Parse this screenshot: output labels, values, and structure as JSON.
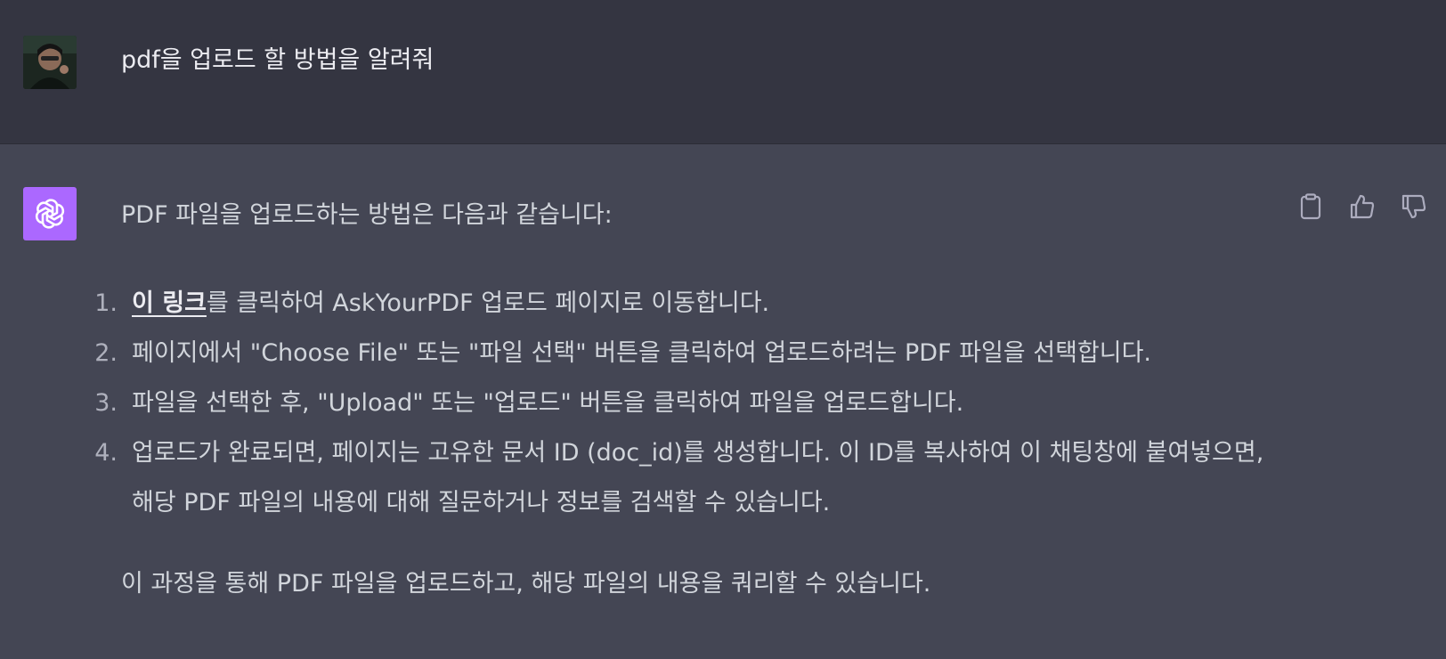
{
  "user": {
    "message": "pdf을 업로드 할 방법을 알려줘",
    "avatar_icon": "user-avatar"
  },
  "assistant": {
    "avatar_icon": "openai-logo-icon",
    "avatar_color": "#ab68ff",
    "intro": "PDF 파일을 업로드하는 방법은 다음과 같습니다:",
    "steps": [
      {
        "num": "1.",
        "link": "이 링크",
        "text": "를 클릭하여 AskYourPDF 업로드 페이지로 이동합니다."
      },
      {
        "num": "2.",
        "text": "페이지에서 \"Choose File\" 또는 \"파일 선택\" 버튼을 클릭하여 업로드하려는 PDF 파일을 선택합니다."
      },
      {
        "num": "3.",
        "text": "파일을 선택한 후, \"Upload\" 또는 \"업로드\" 버튼을 클릭하여 파일을 업로드합니다."
      },
      {
        "num": "4.",
        "text": "업로드가 완료되면, 페이지는 고유한 문서 ID (doc_id)를 생성합니다. 이 ID를 복사하여 이 채팅창에 붙여넣으면, 해당 PDF 파일의 내용에 대해 질문하거나 정보를 검색할 수 있습니다."
      }
    ],
    "closing": "이 과정을 통해 PDF 파일을 업로드하고, 해당 파일의 내용을 쿼리할 수 있습니다.",
    "actions": [
      "clipboard-icon",
      "thumbs-up-icon",
      "thumbs-down-icon"
    ]
  },
  "colors": {
    "user_bg": "#343541",
    "assistant_bg": "#444654",
    "text": "#d1d5db"
  }
}
